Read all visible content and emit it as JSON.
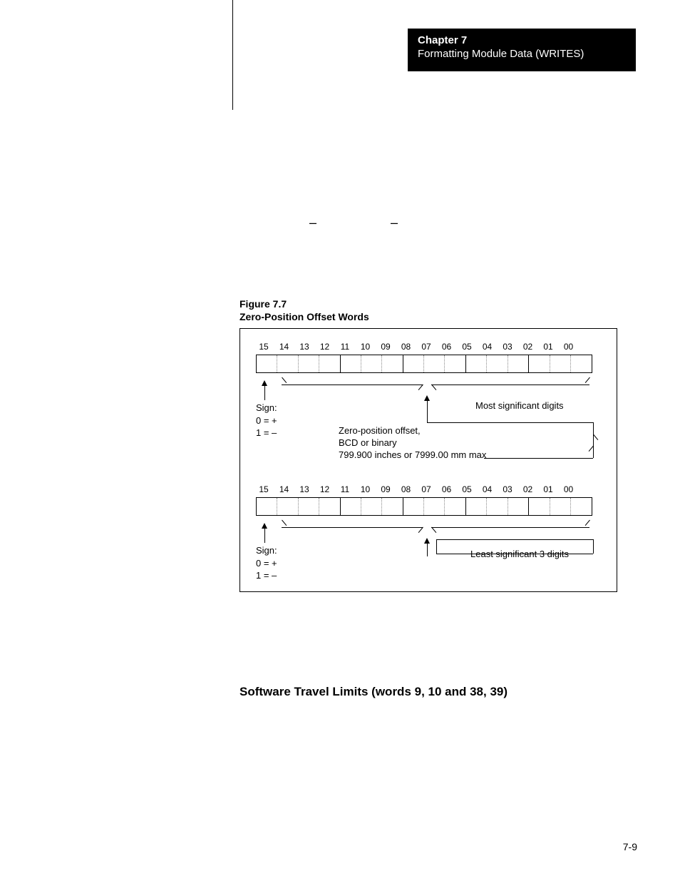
{
  "header": {
    "chapter": "Chapter 7",
    "title": "Formatting Module Data (WRITES)"
  },
  "mid_marks": {
    "a": "–",
    "b": "–"
  },
  "figure": {
    "number": "Figure 7.7",
    "title": "Zero-Position Offset Words"
  },
  "bits": [
    "15",
    "14",
    "13",
    "12",
    "11",
    "10",
    "09",
    "08",
    "07",
    "06",
    "05",
    "04",
    "03",
    "02",
    "01",
    "00"
  ],
  "sign": {
    "label": "Sign:",
    "line1": "0 = +",
    "line2": "1 = –"
  },
  "annotations": {
    "most_sig": "Most significant digits",
    "least_sig": "Least significant 3 digits",
    "zero_pos_l1": "Zero-position offset,",
    "zero_pos_l2": "BCD or binary",
    "zero_pos_l3": "799.900 inches or 7999.00 mm max"
  },
  "section_heading": "Software Travel Limits (words 9, 10 and 38, 39)",
  "page_number": "7-9",
  "chart_data": {
    "type": "table",
    "description": "Two 16-bit word layouts for Zero-Position Offset",
    "bit_positions": [
      "15",
      "14",
      "13",
      "12",
      "11",
      "10",
      "09",
      "08",
      "07",
      "06",
      "05",
      "04",
      "03",
      "02",
      "01",
      "00"
    ],
    "words": [
      {
        "bit15": "Sign (0=+, 1=–)",
        "bits_14_00": "Zero-position offset (BCD or binary), 799.900 inches or 7999.00 mm max — Most significant digits"
      },
      {
        "bit15": "Sign (0=+, 1=–)",
        "bits_14_00": "Least significant 3 digits"
      }
    ]
  }
}
